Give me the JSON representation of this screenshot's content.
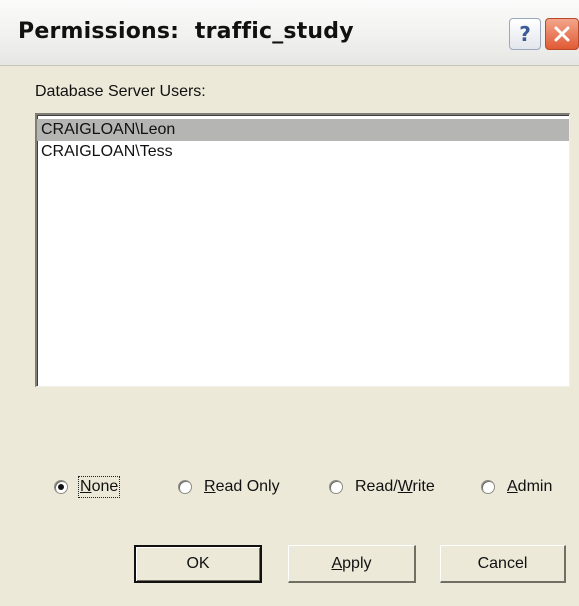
{
  "window": {
    "title": "Permissions:  traffic_study",
    "help_glyph": "?",
    "close_color": "#e05a34"
  },
  "users_label": "Database Server Users:",
  "users": [
    {
      "name": "CRAIGLOAN\\Leon",
      "selected": true
    },
    {
      "name": "CRAIGLOAN\\Tess",
      "selected": false
    }
  ],
  "permissions": {
    "selected": "None",
    "options": [
      {
        "pre": "",
        "key": "N",
        "post": "one"
      },
      {
        "pre": "",
        "key": "R",
        "post": "ead Only"
      },
      {
        "pre": "Read/",
        "key": "W",
        "post": "rite"
      },
      {
        "pre": "",
        "key": "A",
        "post": "dmin"
      }
    ]
  },
  "buttons": {
    "ok": "OK",
    "apply_key": "A",
    "apply_rest": "pply",
    "cancel": "Cancel"
  }
}
